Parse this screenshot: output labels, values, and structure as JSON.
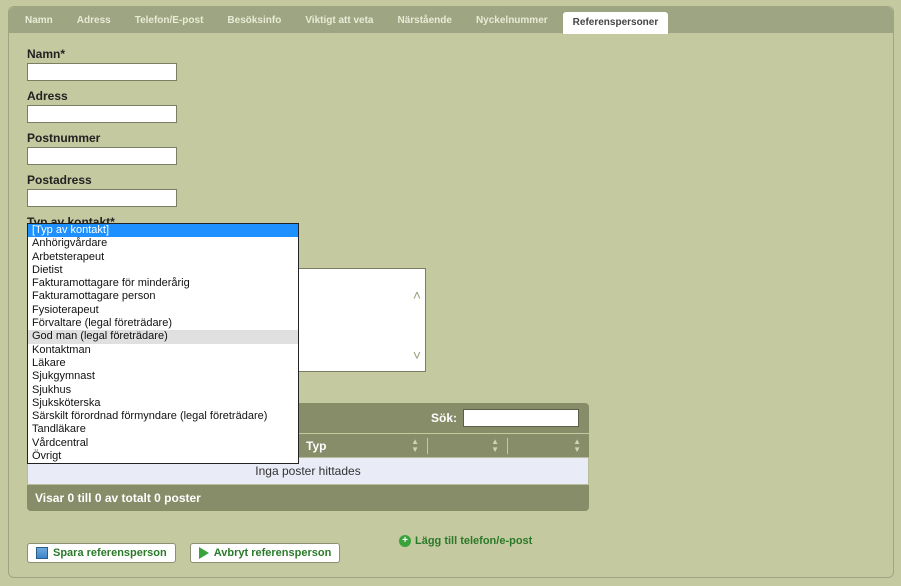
{
  "tabs": [
    {
      "label": "Namn"
    },
    {
      "label": "Adress"
    },
    {
      "label": "Telefon/E-post"
    },
    {
      "label": "Besöksinfo"
    },
    {
      "label": "Viktigt att veta"
    },
    {
      "label": "Närstående"
    },
    {
      "label": "Nyckelnummer"
    },
    {
      "label": "Referenspersoner"
    }
  ],
  "form": {
    "namn_label": "Namn*",
    "adress_label": "Adress",
    "postnummer_label": "Postnummer",
    "postadress_label": "Postadress",
    "typ_label": "Typ av kontakt*"
  },
  "kontakt_options": [
    "[Typ av kontakt]",
    "Anhörigvårdare",
    "Arbetsterapeut",
    "Dietist",
    "Fakturamottagare för minderårig",
    "Fakturamottagare person",
    "Fysioterapeut",
    "Förvaltare (legal företrädare)",
    "God man (legal företrädare)",
    "Kontaktman",
    "Läkare",
    "Sjukgymnast",
    "Sjukhus",
    "Sjuksköterska",
    "Särskilt förordnad förmyndare (legal företrädare)",
    "Tandläkare",
    "Vårdcentral",
    "Övrigt"
  ],
  "kontakt_selected_index": 0,
  "kontakt_hover_index": 8,
  "table": {
    "search_label": "Sök:",
    "col_typ": "Typ",
    "empty": "Inga poster hittades",
    "footer": "Visar 0 till 0 av totalt 0 poster"
  },
  "add_link": "Lägg till telefon/e-post",
  "buttons": {
    "save": "Spara referensperson",
    "cancel": "Avbryt referensperson"
  }
}
